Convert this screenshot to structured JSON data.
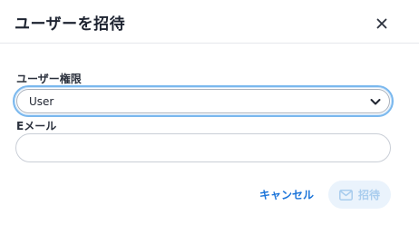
{
  "dialog": {
    "title": "ユーザーを招待"
  },
  "form": {
    "role": {
      "label": "ユーザー権限",
      "value": "User"
    },
    "email": {
      "label": "Eメール",
      "value": "",
      "placeholder": ""
    }
  },
  "actions": {
    "cancel_label": "キャンセル",
    "invite_label": "招待"
  },
  "icons": {
    "close": "close-icon",
    "chevron": "chevron-down-icon",
    "invite": "mail-icon"
  },
  "colors": {
    "accent": "#1b74d9",
    "focus_ring": "#7ab8ee",
    "disabled_button_bg": "#eaf3fc",
    "disabled_button_text": "#a9cdee"
  }
}
